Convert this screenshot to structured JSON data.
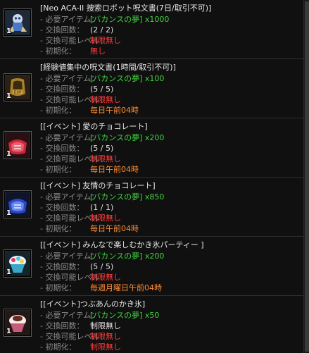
{
  "labels": {
    "required_item": "- 必要アイテム：",
    "exchange_count": "- 交換回数：",
    "exchange_level": "- 交換可能レベル：",
    "reset": "- 初期化："
  },
  "entries": [
    {
      "title": "[Neo ACA-II 捜索ロボット呪文書(7日/取引不可)]",
      "item": "[バカンスの夢] x1000",
      "count": "(2 / 2)",
      "level": "制限無し",
      "reset": "無し",
      "reset_color": "red",
      "qty": "1",
      "icon": "robot-scroll-icon"
    },
    {
      "title": "[経験値集中の呪文書(1時間/取引不可)]",
      "item": "[バカンスの夢] x100",
      "count": "(5 / 5)",
      "level": "制限無し",
      "reset": "毎日午前04時",
      "reset_color": "orange",
      "qty": "1",
      "icon": "exp-scroll-icon"
    },
    {
      "title": "[[イベント] 愛のチョコレート]",
      "item": "[バカンスの夢] x200",
      "count": "(5 / 5)",
      "level": "制限無し",
      "reset": "毎日午前04時",
      "reset_color": "orange",
      "qty": "1",
      "icon": "red-chocolate-icon"
    },
    {
      "title": "[[イベント] 友情のチョコレート]",
      "item": "[バカンスの夢] x850",
      "count": "(1 / 1)",
      "level": "制限無し",
      "reset": "毎日午前04時",
      "reset_color": "orange",
      "qty": "1",
      "icon": "blue-chocolate-icon"
    },
    {
      "title": "[[イベント] みんなで楽しむかき氷パーティー ]",
      "item": "[バカンスの夢] x200",
      "count": "(5 / 5)",
      "level": "制限無し",
      "reset": "毎週月曜日午前04時",
      "reset_color": "orange",
      "qty": "1",
      "icon": "shaved-ice-party-icon"
    },
    {
      "title": "[[イベント]つぶあんのかき氷]",
      "item": "[バカンスの夢] x50",
      "count": "制限無し",
      "level": "制限無し",
      "reset": "制限無し",
      "reset_color": "red",
      "qty": "1",
      "icon": "red-bean-shaved-ice-icon"
    }
  ],
  "colors": {
    "background": "#101010",
    "item_green": "#3fd23f",
    "limit_red": "#ff3a3a",
    "reset_orange": "#ff8c32",
    "label_gray": "#8a8a8a"
  }
}
